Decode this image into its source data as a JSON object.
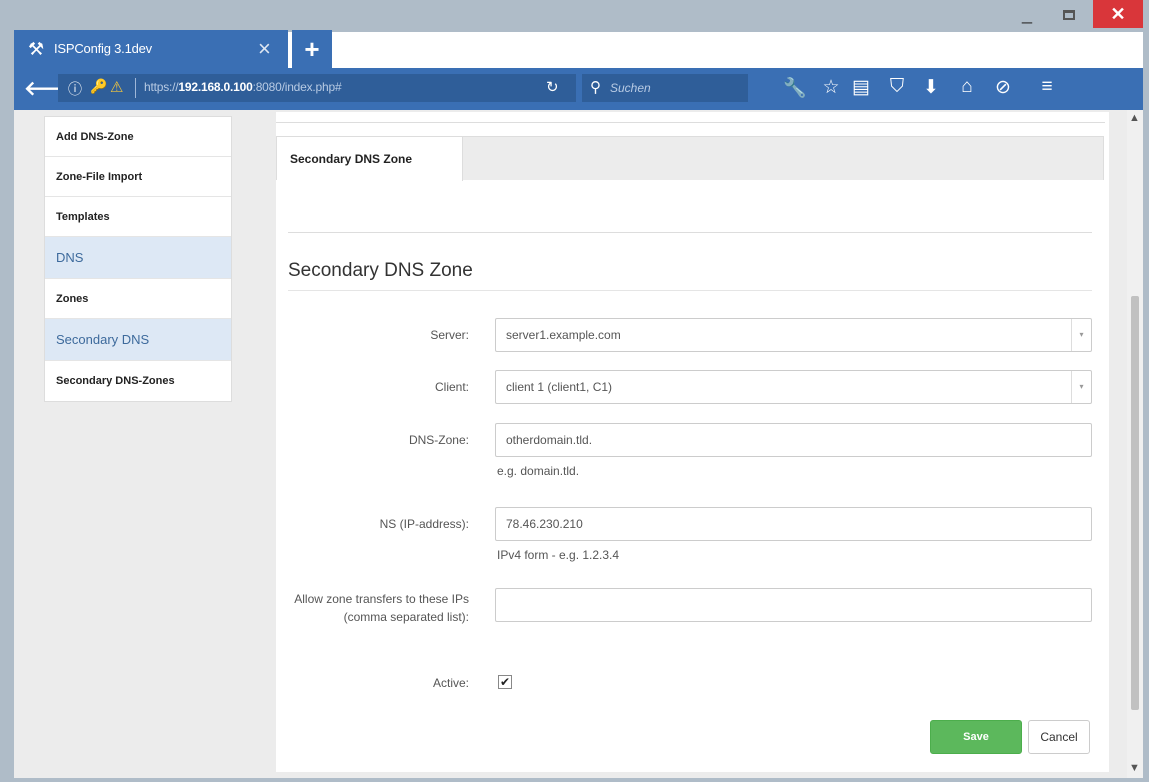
{
  "browser": {
    "tab_title": "ISPConfig 3.1dev",
    "tab_close": "×",
    "new_tab": "+",
    "url_prefix": "https://",
    "url_host": "192.168.0.100",
    "url_rest": ":8080/index.php#",
    "search_placeholder": "Suchen",
    "window_min": "_",
    "window_close": "✕"
  },
  "sidebar": {
    "items": [
      {
        "label": "Add DNS-Zone",
        "type": "item"
      },
      {
        "label": "Zone-File Import",
        "type": "item"
      },
      {
        "label": "Templates",
        "type": "item"
      },
      {
        "label": "DNS",
        "type": "header"
      },
      {
        "label": "Zones",
        "type": "item"
      },
      {
        "label": "Secondary DNS",
        "type": "header"
      },
      {
        "label": "Secondary DNS-Zones",
        "type": "item"
      }
    ]
  },
  "main": {
    "tab_label": "Secondary DNS Zone",
    "form_title": "Secondary DNS Zone",
    "fields": {
      "server": {
        "label": "Server:",
        "value": "server1.example.com"
      },
      "client": {
        "label": "Client:",
        "value": "client 1 (client1, C1)"
      },
      "dns_zone": {
        "label": "DNS-Zone:",
        "value": "otherdomain.tld.",
        "hint": "e.g. domain.tld."
      },
      "ns": {
        "label": "NS (IP-address):",
        "value": "78.46.230.210",
        "hint": "IPv4 form - e.g. 1.2.3.4"
      },
      "xfer": {
        "label": "Allow zone transfers to these IPs (comma separated list):",
        "value": ""
      },
      "active": {
        "label": "Active:",
        "checked": true
      }
    },
    "save_label": "Save",
    "cancel_label": "Cancel"
  },
  "colors": {
    "browser_blue": "#3a6fb4",
    "save_green": "#5cb85c",
    "sidebar_header_bg": "#dde8f5",
    "close_red": "#d9363a"
  }
}
